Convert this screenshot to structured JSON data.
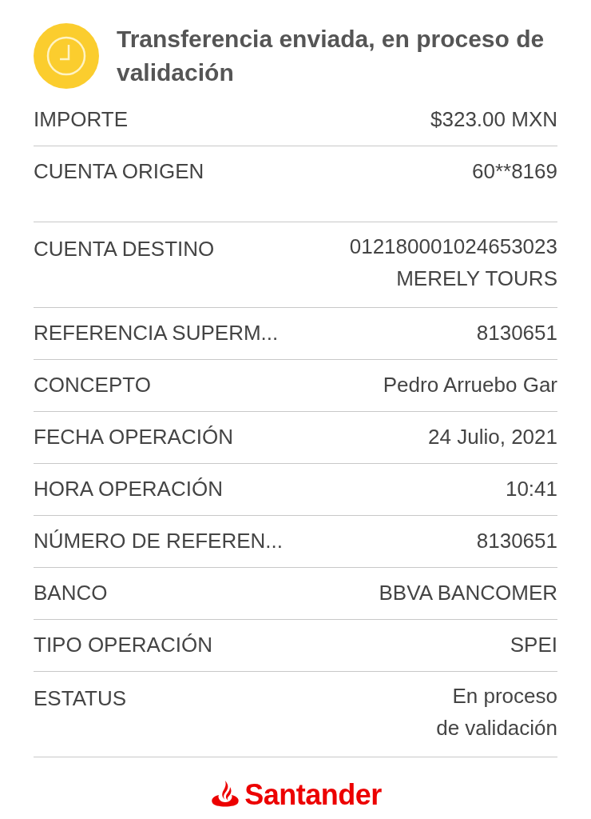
{
  "header": {
    "title": "Transferencia enviada, en proceso de validación"
  },
  "details": [
    {
      "label": "IMPORTE",
      "value": [
        "$323.00 MXN"
      ]
    },
    {
      "label": "CUENTA ORIGEN",
      "value": [
        "60**8169"
      ]
    },
    {
      "label": "CUENTA DESTINO",
      "value": [
        "012180001024653023",
        "MERELY TOURS"
      ]
    },
    {
      "label": "REFERENCIA SUPERM...",
      "value": [
        "8130651"
      ]
    },
    {
      "label": "CONCEPTO",
      "value": [
        "Pedro Arruebo Gar"
      ]
    },
    {
      "label": "FECHA OPERACIÓN",
      "value": [
        "24 Julio, 2021"
      ]
    },
    {
      "label": "HORA OPERACIÓN",
      "value": [
        "10:41"
      ]
    },
    {
      "label": "NÚMERO DE REFEREN...",
      "value": [
        "8130651"
      ]
    },
    {
      "label": "BANCO",
      "value": [
        "BBVA BANCOMER"
      ]
    },
    {
      "label": "TIPO OPERACIÓN",
      "value": [
        "SPEI"
      ]
    },
    {
      "label": "ESTATUS",
      "value": [
        "En proceso",
        "de validación"
      ]
    }
  ],
  "footer": {
    "brand": "Santander"
  }
}
